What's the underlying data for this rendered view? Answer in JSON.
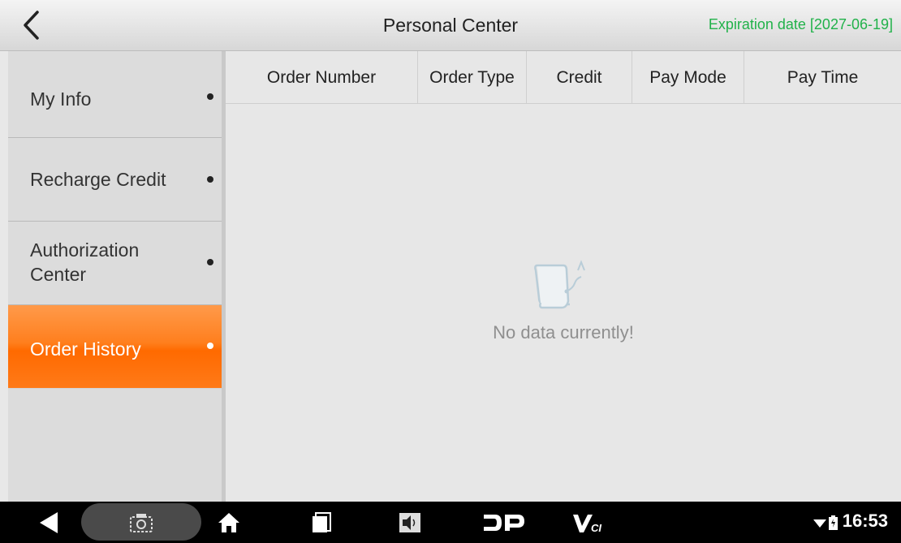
{
  "header": {
    "back_icon": "chevron-left-icon",
    "title": "Personal Center",
    "expiration": "Expiration date [2027-06-19]",
    "expiration_color": "#21b24a"
  },
  "sidebar": {
    "items": [
      {
        "label": "My Info",
        "active": false
      },
      {
        "label": "Recharge Credit",
        "active": false
      },
      {
        "label": "Authorization Center",
        "active": false
      },
      {
        "label": "Order History",
        "active": true
      }
    ],
    "active_color": "#ff7a18"
  },
  "table": {
    "columns": [
      "Order Number",
      "Order Type",
      "Credit",
      "Pay Mode",
      "Pay Time"
    ],
    "rows": []
  },
  "empty_state": {
    "icon": "empty-document-icon",
    "message": "No data currently!"
  },
  "navbar": {
    "icons": [
      "back-triangle-icon",
      "screenshot-icon",
      "home-icon",
      "recent-apps-icon",
      "volume-icon",
      "dp-logo-icon",
      "vci-logo-icon"
    ],
    "status": {
      "wifi": "wifi-icon",
      "battery": "battery-icon",
      "time": "16:53"
    }
  }
}
